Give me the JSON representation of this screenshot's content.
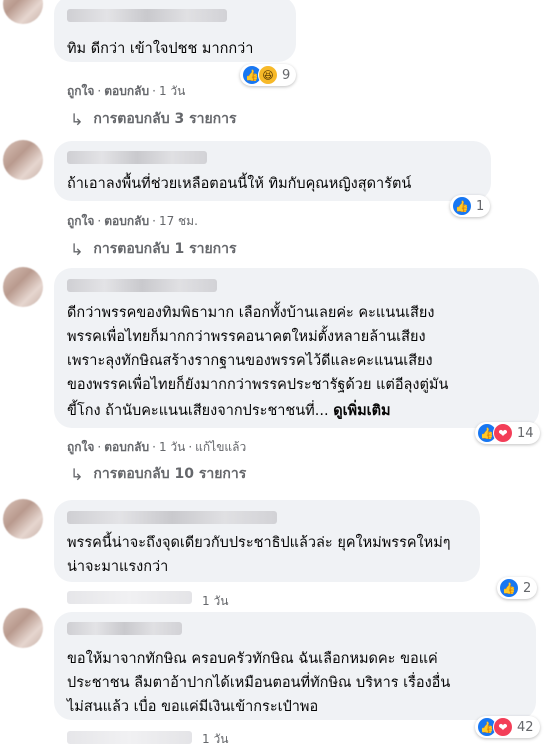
{
  "ui": {
    "like": "ถูกใจ",
    "reply": "ตอบกลับ",
    "dot": "·",
    "see_more": "ดูเพิ่มเติม"
  },
  "comments": [
    {
      "text": "ทิม ดีกว่า เข้าใจปชช มากกว่า",
      "time": "1 วัน",
      "reactions": [
        "like",
        "haha"
      ],
      "reaction_count": "9",
      "replies_label": "การตอบกลับ 3 รายการ"
    },
    {
      "text": "ถ้าเอาลงพื้นที่ช่วยเหลือตอนนี้ให้ ทิมกับคุณหญิงสุดารัตน์",
      "time": "17 ชม.",
      "reactions": [
        "like"
      ],
      "reaction_count": "1",
      "replies_label": "การตอบกลับ 1 รายการ"
    },
    {
      "lines": [
        "ดีกว่าพรรคของทิมพิธามาก เลือกทั้งบ้านเลยค่ะ คะแนนเสียง",
        "พรรคเพื่อไทยก็มากกว่าพรรคอนาคตใหม่ตั้งหลายล้านเสียง",
        "เพราะลุงทักษิณสร้างรากฐานของพรรคไว้ดีและคะแนนเสียง",
        "ของพรรคเพื่อไทยก็ยังมากกว่าพรรคประชารัฐด้วย แต่อีลุงตู่มัน",
        "ขี้โกง ถ้านับคะแนนเสียงจากประชาชนที่..."
      ],
      "time": "1 วัน",
      "edited": "แก้ไขแล้ว",
      "reactions": [
        "like",
        "love"
      ],
      "reaction_count": "14",
      "replies_label": "การตอบกลับ 10 รายการ"
    },
    {
      "lines": [
        "พรรคนี้น่าจะถึงจุดเดียวกับประชาธิปแล้วล่ะ ยุคใหม่พรรคใหม่ๆ",
        "น่าจะมาแรงกว่า"
      ],
      "time": "1 วัน",
      "reactions": [
        "like"
      ],
      "reaction_count": "2"
    },
    {
      "lines": [
        "ขอให้มาจากทักษิณ ครอบครัวทักษิณ ฉันเลือกหมดคะ ขอแค่",
        "ประชาชน ลืมตาอ้าปากได้เหมือนตอนที่ทักษิณ บริหาร เรื่องอื่น",
        "ไม่สนแล้ว เบื่อ ขอแค่มีเงินเข้ากระเป๋าพอ"
      ],
      "time": "1 วัน",
      "reactions": [
        "like",
        "love"
      ],
      "reaction_count": "42"
    }
  ]
}
